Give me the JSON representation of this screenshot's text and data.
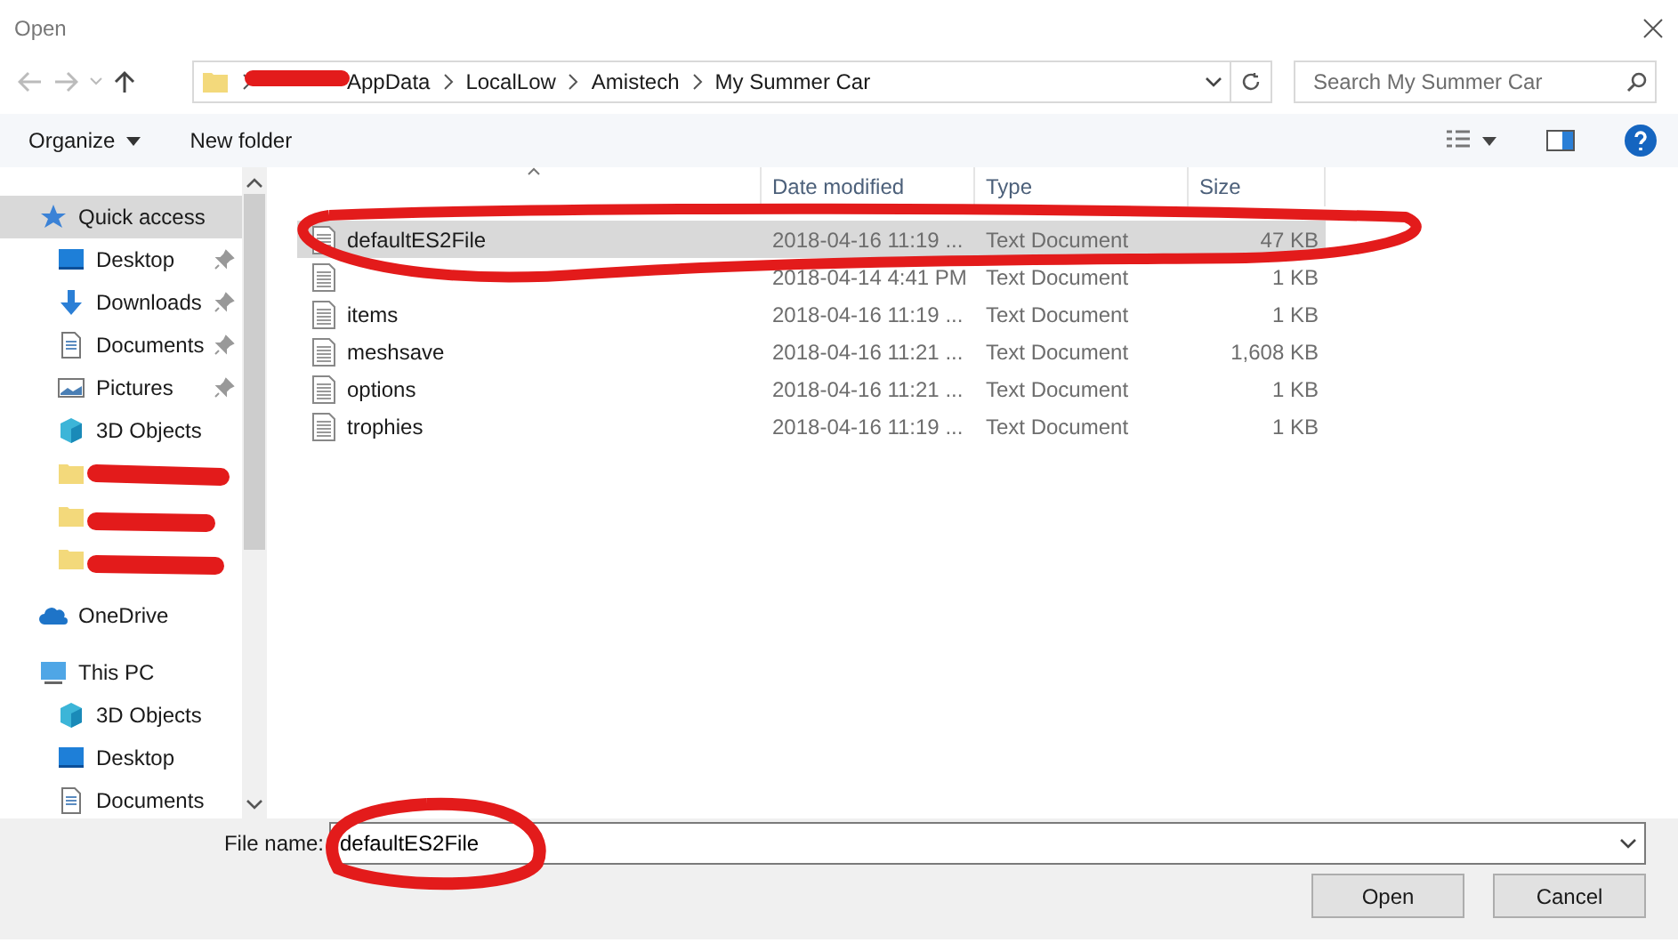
{
  "window": {
    "title": "Open"
  },
  "address": {
    "crumbs": [
      "AppData",
      "LocalLow",
      "Amistech",
      "My Summer Car"
    ]
  },
  "search": {
    "placeholder": "Search My Summer Car"
  },
  "toolbar": {
    "organize": "Organize",
    "new_folder": "New folder"
  },
  "sidebar": {
    "sections": [
      {
        "label": "Quick access",
        "kind": "star",
        "selected": true,
        "children": [
          {
            "label": "Desktop",
            "kind": "desktop",
            "pinned": true,
            "selected": false
          },
          {
            "label": "Downloads",
            "kind": "download",
            "pinned": true,
            "selected": false
          },
          {
            "label": "Documents",
            "kind": "document",
            "pinned": true,
            "selected": false
          },
          {
            "label": "Pictures",
            "kind": "picture",
            "pinned": true,
            "selected": false
          },
          {
            "label": "3D Objects",
            "kind": "cube",
            "pinned": false,
            "selected": false
          },
          {
            "kind": "folder"
          },
          {
            "kind": "folder"
          },
          {
            "kind": "folder"
          }
        ]
      },
      {
        "label": "OneDrive",
        "kind": "cloud",
        "selected": false
      },
      {
        "label": "This PC",
        "kind": "pc",
        "selected": false,
        "children": [
          {
            "label": "3D Objects",
            "kind": "cube",
            "pinned": false,
            "selected": false
          },
          {
            "label": "Desktop",
            "kind": "desktop",
            "pinned": false,
            "selected": false
          },
          {
            "label": "Documents",
            "kind": "document",
            "pinned": false,
            "selected": false
          }
        ]
      }
    ]
  },
  "table": {
    "columns": [
      "",
      "Date modified",
      "Type",
      "Size"
    ],
    "rows": [
      {
        "name": "defaultES2File",
        "date": "2018-04-16 11:19 ...",
        "type": "Text Document",
        "size": "47 KB",
        "selected": true
      },
      {
        "date": "2018-04-14 4:41 PM",
        "type": "Text Document",
        "size": "1 KB",
        "selected": false
      },
      {
        "name": "items",
        "date": "2018-04-16 11:19 ...",
        "type": "Text Document",
        "size": "1 KB",
        "selected": false
      },
      {
        "name": "meshsave",
        "date": "2018-04-16 11:21 ...",
        "type": "Text Document",
        "size": "1,608 KB",
        "selected": false
      },
      {
        "name": "options",
        "date": "2018-04-16 11:21 ...",
        "type": "Text Document",
        "size": "1 KB",
        "selected": false
      },
      {
        "name": "trophies",
        "date": "2018-04-16 11:19 ...",
        "type": "Text Document",
        "size": "1 KB",
        "selected": false
      }
    ]
  },
  "footer": {
    "file_name_label": "File name:",
    "file_name": "defaultES2File",
    "buttons": [
      "Open",
      "Cancel"
    ]
  }
}
